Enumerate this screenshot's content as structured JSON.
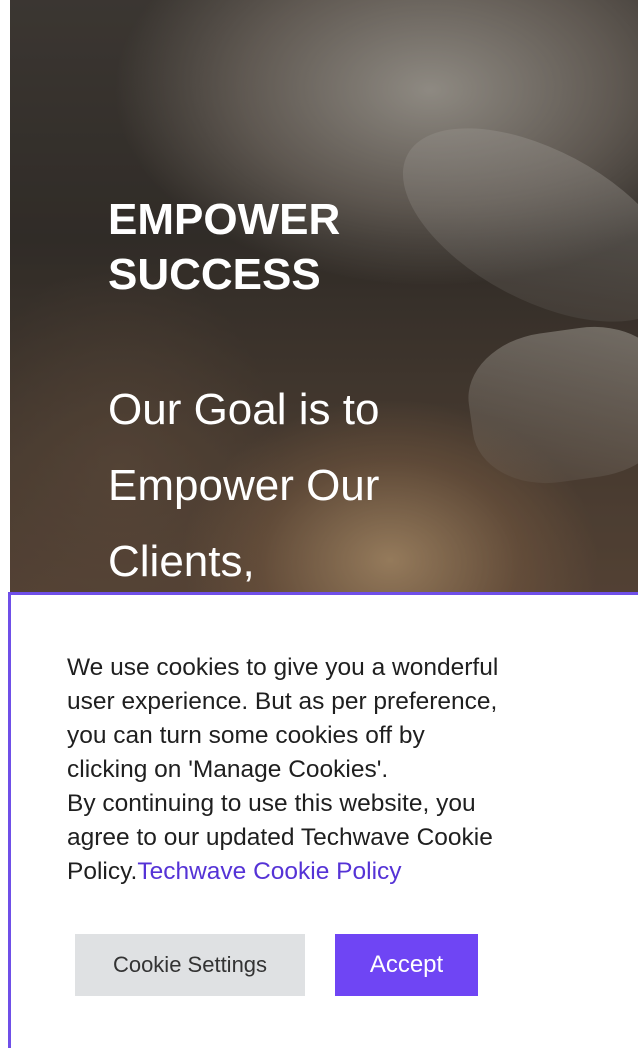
{
  "hero": {
    "eyebrow": "EMPOWER\nSUCCESS",
    "headline": "Our Goal is to\nEmpower Our\nClients,"
  },
  "cookie_banner": {
    "text_lines": [
      "We use cookies to give you a wonderful",
      "user experience. But as per preference,",
      "you can turn some cookies off by",
      "clicking on 'Manage Cookies'.",
      "By continuing to use this website, you",
      "agree to our updated Techwave Cookie"
    ],
    "text_last_prefix": "Policy.",
    "policy_link_label": "Techwave Cookie Policy",
    "settings_button_label": "Cookie Settings",
    "accept_button_label": "Accept"
  },
  "colors": {
    "accent": "#6f45f4",
    "link": "#5533d6",
    "settings_button_bg": "#dfe1e3"
  }
}
